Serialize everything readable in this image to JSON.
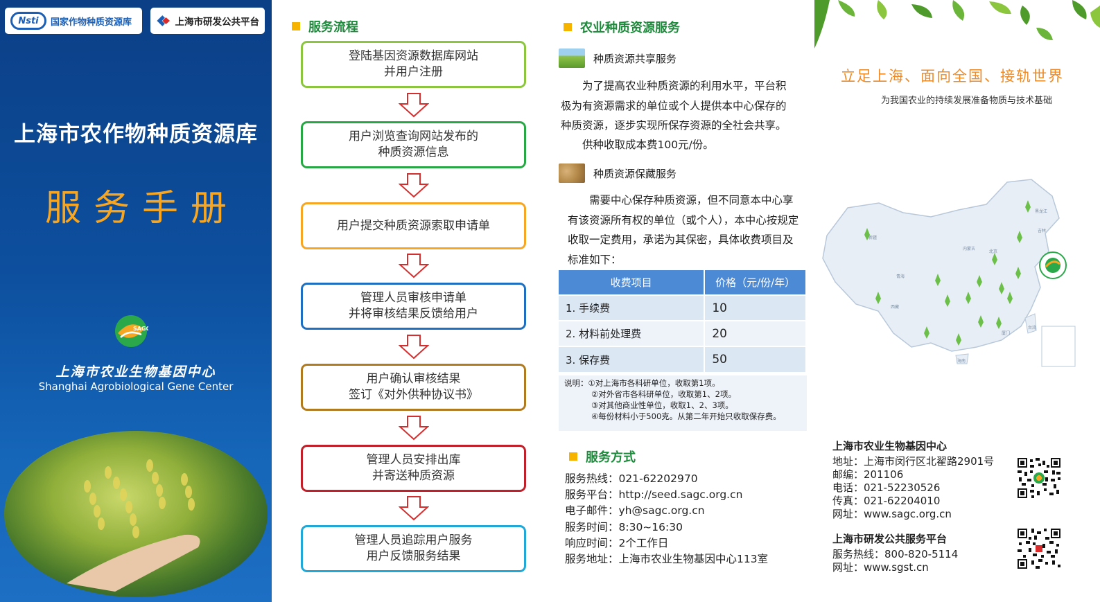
{
  "cover": {
    "logo_nsti_mark": "Nsti",
    "logo_nsti_text": "国家作物种质资源库",
    "logo_platform_text": "上海市研发公共平台",
    "title": "上海市农作物种质资源库",
    "subtitle": "服务手册",
    "sagc_mark": "SAGC",
    "center_cn": "上海市农业生物基因中心",
    "center_en": "Shanghai Agrobiological Gene Center"
  },
  "flow": {
    "heading": "服务流程",
    "steps": [
      {
        "line1": "登陆基因资源数据库网站",
        "line2": "并用户注册",
        "color": "#8cc63f"
      },
      {
        "line1": "用户浏览查询网站发布的",
        "line2": "种质资源信息",
        "color": "#28a745"
      },
      {
        "line1": "用户提交种质资源索取申请单",
        "line2": "",
        "color": "#f6a623"
      },
      {
        "line1": "管理人员审核申请单",
        "line2": "并将审核结果反馈给用户",
        "color": "#1e6fbf"
      },
      {
        "line1": "用户确认审核结果",
        "line2": "签订《对外供种协议书》",
        "color": "#b07a1e"
      },
      {
        "line1": "管理人员安排出库",
        "line2": "并寄送种质资源",
        "color": "#c0202a"
      },
      {
        "line1": "管理人员追踪用户服务",
        "line2": "用户反馈服务结果",
        "color": "#1fa8d8"
      }
    ]
  },
  "services": {
    "heading": "农业种质资源服务",
    "share": {
      "title": "种质资源共享服务",
      "para1": "为了提高农业种质资源的利用水平，平台积极为有资源需求的单位或个人提供本中心保存的种质资源，逐步实现所保存资源的全社会共享。",
      "para2": "供种收取成本费100元/份。"
    },
    "preserve": {
      "title": "种质资源保藏服务",
      "para": "需要中心保存种质资源，但不同意本中心享有该资源所有权的单位（或个人），本中心按规定收取一定费用，承诺为其保密，具体收费项目及标准如下："
    },
    "table": {
      "headers": [
        "收费项目",
        "价格（元/份/年）"
      ],
      "rows": [
        {
          "item": "1. 手续费",
          "price": "10"
        },
        {
          "item": "2. 材料前处理费",
          "price": "20"
        },
        {
          "item": "3. 保存费",
          "price": "50"
        }
      ]
    },
    "notes": {
      "label": "说明：",
      "lines": [
        "①对上海市各科研单位，收取第1项。",
        "②对外省市各科研单位，收取第1、2项。",
        "③对其他商业性单位，收取1、2、3项。",
        "④每份材料小于500克。从第二年开始只收取保存费。"
      ]
    }
  },
  "service_mode": {
    "heading": "服务方式",
    "rows": [
      "服务热线：021-62202970",
      "服务平台：http://seed.sagc.org.cn",
      "电子邮件：yh@sagc.org.cn",
      "服务时间：8:30~16:30",
      "响应时间：2个工作日",
      "服务地址：上海市农业生物基因中心113室"
    ]
  },
  "panel4": {
    "slogan": "立足上海、面向全国、接轨世界",
    "slogan_sub": "为我国农业的持续发展准备物质与技术基础",
    "map_labels": [
      "新疆",
      "西藏",
      "青海",
      "内蒙古",
      "黑龙江",
      "吉林",
      "北京",
      "台湾",
      "海南",
      "厦门"
    ],
    "org1": {
      "name": "上海市农业生物基因中心",
      "rows": [
        "地址：上海市闵行区北翟路2901号",
        "邮编：201106",
        "电话：021-52230526",
        "传真：021-62204010",
        "网址：www.sagc.org.cn"
      ]
    },
    "org2": {
      "name": "上海市研发公共服务平台",
      "rows": [
        "服务热线：800-820-5114",
        "网址：www.sgst.cn"
      ]
    }
  },
  "colors": {
    "cover_blue": "#0d4f9e",
    "accent_orange": "#f6a623",
    "heading_green": "#1e8a3c",
    "table_header": "#4d8ad6"
  }
}
